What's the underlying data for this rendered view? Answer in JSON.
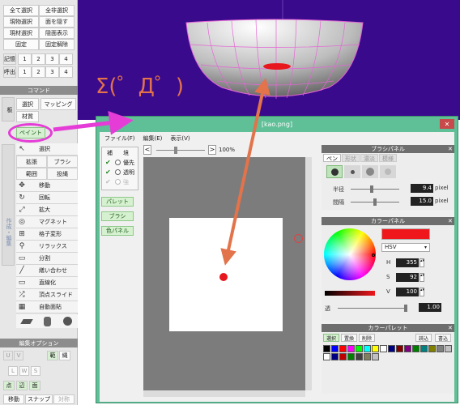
{
  "sidebar": {
    "selection_rows": [
      [
        "全て選択",
        "全非選択"
      ],
      [
        "現物選択",
        "面を隠す"
      ],
      [
        "現材選択",
        "隠面表示"
      ],
      [
        "固定",
        "固定解除"
      ]
    ],
    "memory_label": "記憶",
    "recall_label": "呼出",
    "slot_numbers": [
      "1",
      "2",
      "3",
      "4"
    ],
    "command_header": "コマンド",
    "obj_tab_label": "板",
    "select_label": "選択",
    "mapping_label": "マッピング",
    "material_label": "材質",
    "paint_label": "ペイント",
    "tools": [
      {
        "icon": "↖",
        "label": "選択"
      },
      {
        "icon": "",
        "label": "拡張",
        "pair": "ブラシ"
      },
      {
        "icon": "",
        "label": "範囲",
        "pair": "投縄"
      },
      {
        "icon": "✥",
        "label": "移動"
      },
      {
        "icon": "↻",
        "label": "回転"
      },
      {
        "icon": "⤢",
        "label": "拡大"
      },
      {
        "icon": "◎",
        "label": "マグネット"
      },
      {
        "icon": "⊞",
        "label": "格子変形"
      },
      {
        "icon": "⚲",
        "label": "リラックス"
      },
      {
        "icon": "▭",
        "label": "分割"
      },
      {
        "icon": "╱",
        "label": "繕い合わせ"
      },
      {
        "icon": "▭",
        "label": "直線化"
      },
      {
        "icon": "⤮",
        "label": "頂点スライド"
      },
      {
        "icon": "▦",
        "label": "自動面貼"
      }
    ],
    "edit_side_label": "作成・編集",
    "edit_options_header": "編集オプション",
    "uv_buttons": [
      "U",
      "V"
    ],
    "axis_buttons": [
      "範",
      "縄"
    ],
    "lws_buttons": [
      "L",
      "W",
      "S"
    ],
    "point_buttons": [
      "点",
      "辺",
      "面"
    ],
    "bottom_buttons": [
      "移動",
      "スナップ",
      "対称"
    ]
  },
  "viewport": {
    "emoticon": "Σ(゜Д゜)",
    "background_color": "#3a0a8d"
  },
  "paint_window": {
    "title": "[kao.png]",
    "close_icon_glyph": "✕",
    "menu": [
      "ファイル(F)",
      "編集(E)",
      "表示(V)"
    ],
    "zoom_text": "100%",
    "edit_options": {
      "title_left": "補",
      "title_right": "境",
      "opt1": "優先",
      "opt2": "透明",
      "opt3": "強",
      "opt1_checked": true,
      "opt2_checked": true
    },
    "green_buttons": [
      "パレット",
      "ブラシ",
      "色パネル"
    ],
    "brush_panel": {
      "header": "ブラシパネル",
      "tabs": [
        "ペン",
        "形状",
        "濃淡",
        "模様"
      ],
      "size_label": "半径",
      "size_value": "9.4",
      "spacing_label": "間隔",
      "spacing_value": "15.0",
      "unit": "pixel"
    },
    "color_panel": {
      "header": "カラーパネル",
      "mode": "HSV",
      "h_label": "H",
      "h_value": "355",
      "s_label": "S",
      "s_value": "92",
      "v_label": "V",
      "v_value": "100",
      "alpha_label": "透",
      "alpha_value": "1.00",
      "current_color": "#f0171c"
    },
    "palette_panel": {
      "header": "カラーパレット",
      "buttons": [
        "選択",
        "置換",
        "削除"
      ],
      "right_buttons": [
        "読込",
        "書込"
      ],
      "colors": [
        "#000000",
        "#0000ff",
        "#ff0000",
        "#ff00ff",
        "#00ff00",
        "#00ffff",
        "#ffff00",
        "#ffffff",
        "#000080",
        "#800000",
        "#800080",
        "#008000",
        "#008080",
        "#808000",
        "#808080",
        "#c0c0c0",
        "#ffffff",
        "#000080",
        "#c00000",
        "#008000",
        "#404040",
        "#808060",
        "#c0c0c0"
      ]
    },
    "canvas": {
      "dot_color": "#e8171e"
    }
  },
  "colors": {
    "magenta": "#e53cd7",
    "orange": "#e2734a",
    "window_green": "#5fbf97"
  }
}
